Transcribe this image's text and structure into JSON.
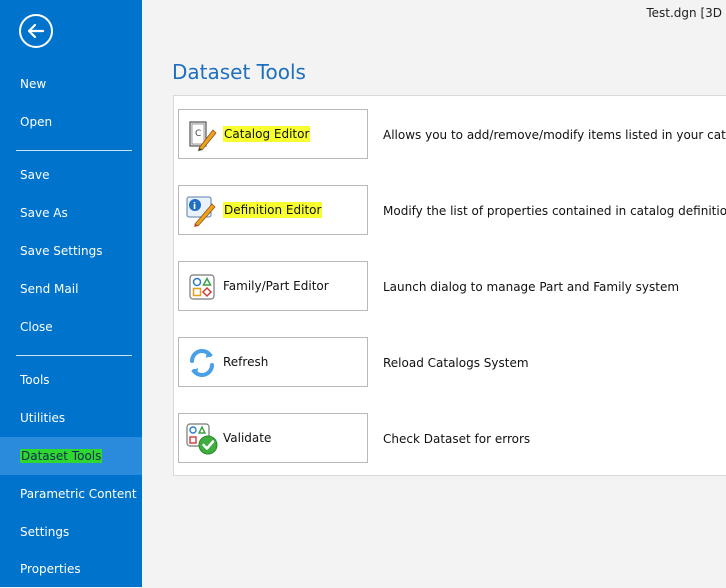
{
  "window": {
    "doc_title": "Test.dgn [3D"
  },
  "sidebar": {
    "items": [
      {
        "label": "New"
      },
      {
        "label": "Open"
      },
      {
        "label": "Save"
      },
      {
        "label": "Save As"
      },
      {
        "label": "Save Settings"
      },
      {
        "label": "Send Mail"
      },
      {
        "label": "Close"
      },
      {
        "label": "Tools"
      },
      {
        "label": "Utilities"
      },
      {
        "label": "Dataset Tools"
      },
      {
        "label": "Parametric Content"
      },
      {
        "label": "Settings"
      },
      {
        "label": "Properties"
      }
    ]
  },
  "main": {
    "title": "Dataset Tools",
    "tools": [
      {
        "label": "Catalog Editor",
        "description": "Allows you to add/remove/modify items listed in your catalogs",
        "icon": "catalog-editor-icon"
      },
      {
        "label": "Definition Editor",
        "description": "Modify the list of properties contained in catalog definitions",
        "icon": "definition-editor-icon"
      },
      {
        "label": "Family/Part Editor",
        "description": "Launch dialog to manage Part and Family system",
        "icon": "family-part-editor-icon"
      },
      {
        "label": "Refresh",
        "description": "Reload Catalogs System",
        "icon": "refresh-icon"
      },
      {
        "label": "Validate",
        "description": "Check Dataset for errors",
        "icon": "validate-icon"
      }
    ]
  },
  "colors": {
    "sidebar_bg": "#0074cc",
    "selected_bg": "#2a8adb",
    "title_blue": "#1e6fbf",
    "highlight_yellow": "#f7ff2e",
    "highlight_green": "#2fd82f"
  }
}
